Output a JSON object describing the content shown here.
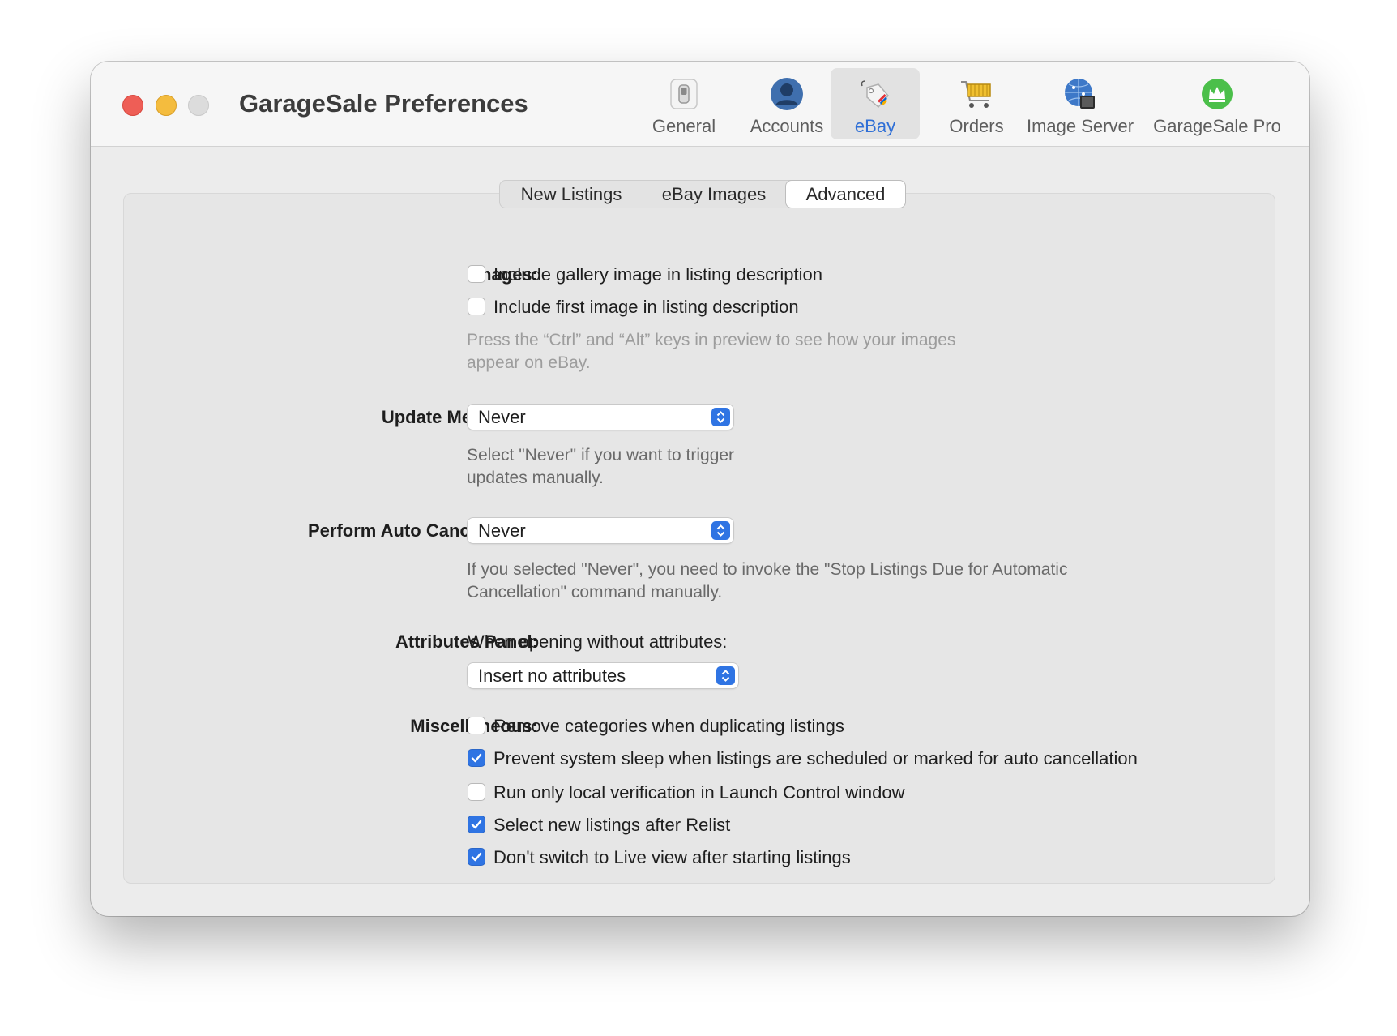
{
  "window": {
    "title": "GarageSale Preferences"
  },
  "toolbar": {
    "items": [
      {
        "label": "General",
        "icon": "switch-icon"
      },
      {
        "label": "Accounts",
        "icon": "person-icon"
      },
      {
        "label": "eBay",
        "icon": "price-tag-icon",
        "selected": true
      },
      {
        "label": "Orders",
        "icon": "shopping-cart-icon"
      },
      {
        "label": "Image Server",
        "icon": "globe-server-icon"
      },
      {
        "label": "GarageSale Pro",
        "icon": "crown-icon"
      }
    ]
  },
  "tabs": {
    "items": [
      "New Listings",
      "eBay Images",
      "Advanced"
    ],
    "active": "Advanced"
  },
  "images": {
    "label": "Images:",
    "options": [
      {
        "label": "Include gallery image in listing description",
        "checked": false
      },
      {
        "label": "Include first image in listing description",
        "checked": false
      }
    ],
    "hint_line1": "Press the “Ctrl” and “Alt” keys in preview to see how your images",
    "hint_line2": "appear on eBay."
  },
  "update_messages": {
    "label": "Update Messages:",
    "value": "Never",
    "hint_line1": "Select \"Never\" if you want to trigger",
    "hint_line2": "updates manually."
  },
  "auto_cancellation": {
    "label": "Perform Auto Cancellation:",
    "value": "Never",
    "hint_line1": "If you selected \"Never\", you need to invoke the \"Stop Listings Due for Automatic",
    "hint_line2": "Cancellation\" command manually."
  },
  "attributes_panel": {
    "label": "Attributes Panel:",
    "description": "When opening without attributes:",
    "value": "Insert no attributes"
  },
  "miscellaneous": {
    "label": "Miscellaneous:",
    "options": [
      {
        "label": "Remove categories when duplicating listings",
        "checked": false
      },
      {
        "label": "Prevent system sleep when listings are scheduled or marked for auto cancellation",
        "checked": true
      },
      {
        "label": "Run only local verification in Launch Control window",
        "checked": false
      },
      {
        "label": "Select new listings after Relist",
        "checked": true
      },
      {
        "label": "Don't switch to Live view after starting listings",
        "checked": true
      }
    ]
  },
  "colors": {
    "accent": "#2f74e3",
    "selected_toolbar_label": "#2f6fd6",
    "close": "#ee5e56",
    "minimize": "#f4bc3e"
  }
}
